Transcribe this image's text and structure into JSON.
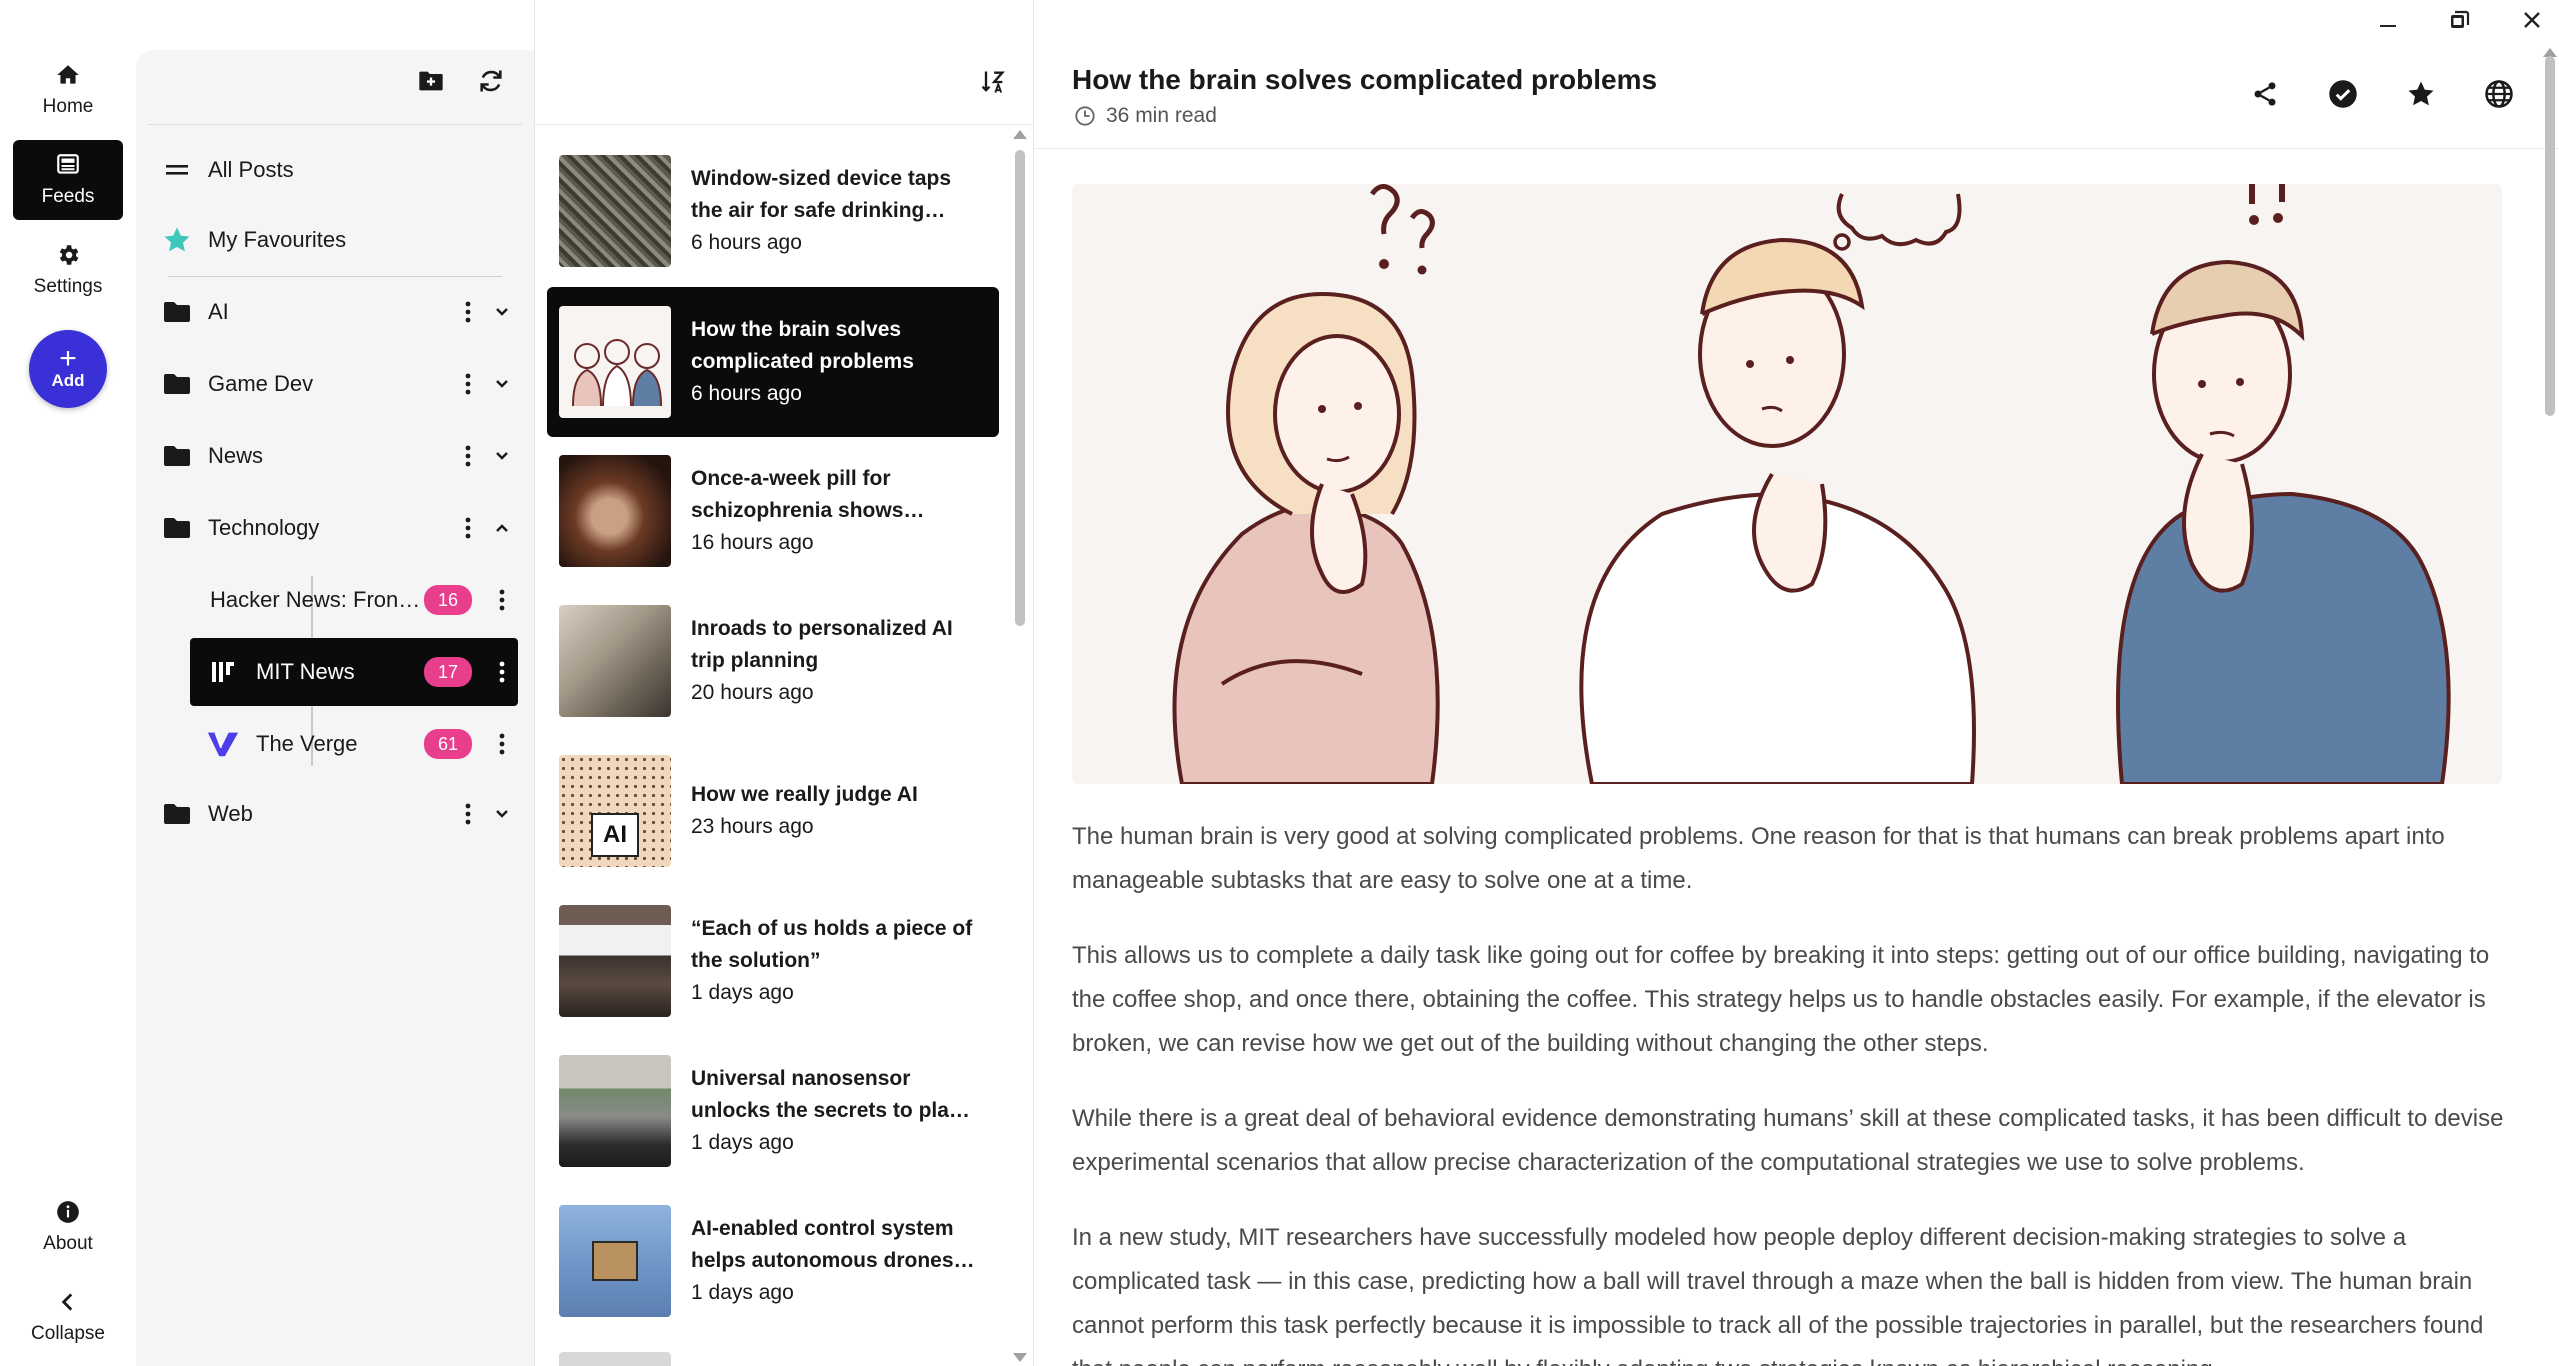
{
  "window": {
    "minimize": "minimize-icon",
    "restore": "restore-icon",
    "close": "close-icon"
  },
  "rail": {
    "home": "Home",
    "feeds": "Feeds",
    "settings": "Settings",
    "add_plus": "+",
    "add": "Add",
    "about": "About",
    "collapse": "Collapse"
  },
  "sidebar": {
    "all_posts": "All Posts",
    "favourites": "My Favourites",
    "folders": [
      {
        "label": "AI"
      },
      {
        "label": "Game Dev"
      },
      {
        "label": "News"
      },
      {
        "label": "Technology"
      },
      {
        "label": "Web"
      }
    ],
    "feeds": [
      {
        "label": "Hacker News: Front Page",
        "count": "16"
      },
      {
        "label": "MIT News",
        "count": "17"
      },
      {
        "label": "The Verge",
        "count": "61"
      }
    ],
    "accent": "#e83e8c"
  },
  "posts": [
    {
      "title": "Window-sized device taps the air for safe drinking water",
      "time": "6 hours ago"
    },
    {
      "title": "How the brain solves complicated problems",
      "time": "6 hours ago"
    },
    {
      "title": "Once-a-week pill for schizophrenia shows promise",
      "time": "16 hours ago"
    },
    {
      "title": "Inroads to personalized AI trip planning",
      "time": "20 hours ago"
    },
    {
      "title": "How we really judge AI",
      "time": "23 hours ago"
    },
    {
      "title": "“Each of us holds a piece of the solution”",
      "time": "1 days ago"
    },
    {
      "title": "Universal nanosensor unlocks the secrets to plant growth",
      "time": "1 days ago"
    },
    {
      "title": "AI-enabled control system helps autonomous drones stay on target",
      "time": "1 days ago"
    }
  ],
  "article": {
    "title": "How the brain solves complicated problems",
    "read_time": "36 min read",
    "paragraphs": [
      "The human brain is very good at solving complicated problems. One reason for that is that humans can break problems apart into manageable subtasks that are easy to solve one at a time.",
      "This allows us to complete a daily task like going out for coffee by breaking it into steps: getting out of our office building, navigating to the coffee shop, and once there, obtaining the coffee. This strategy helps us to handle obstacles easily. For example, if the elevator is broken, we can revise how we get out of the building without changing the other steps.",
      "While there is a great deal of behavioral evidence demonstrating humans’ skill at these complicated tasks, it has been difficult to devise experimental scenarios that allow precise characterization of the computational strategies we use to solve problems.",
      "In a new study, MIT researchers have successfully modeled how people deploy different decision-making strategies to solve a complicated task — in this case, predicting how a ball will travel through a maze when the ball is hidden from view. The human brain cannot perform this task perfectly because it is impossible to track all of the possible trajectories in parallel, but the researchers found that people can perform reasonably well by flexibly adopting two strategies known as hierarchical reasoning"
    ]
  }
}
